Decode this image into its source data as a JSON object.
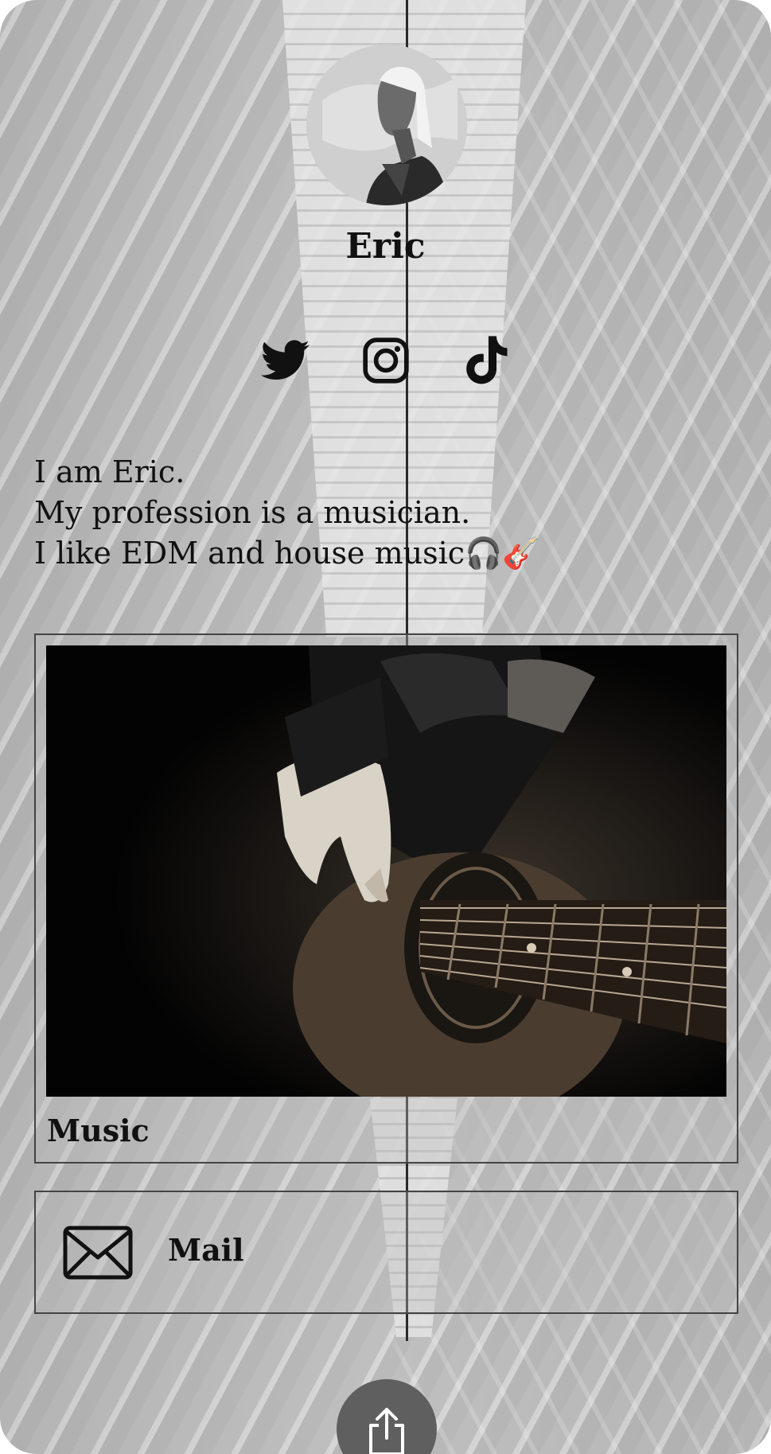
{
  "profile": {
    "name": "Eric"
  },
  "socials": [
    {
      "icon": "twitter-icon"
    },
    {
      "icon": "instagram-icon"
    },
    {
      "icon": "tiktok-icon"
    }
  ],
  "bio": {
    "lines": [
      "I am Eric.",
      "My profession is a musician.",
      "I like EDM and house music🎧🎸"
    ]
  },
  "links": {
    "music_label": "Music",
    "mail_label": "Mail"
  },
  "colors": {
    "text": "#111111",
    "border": "#444444",
    "share_button": "#5f5f5f"
  }
}
